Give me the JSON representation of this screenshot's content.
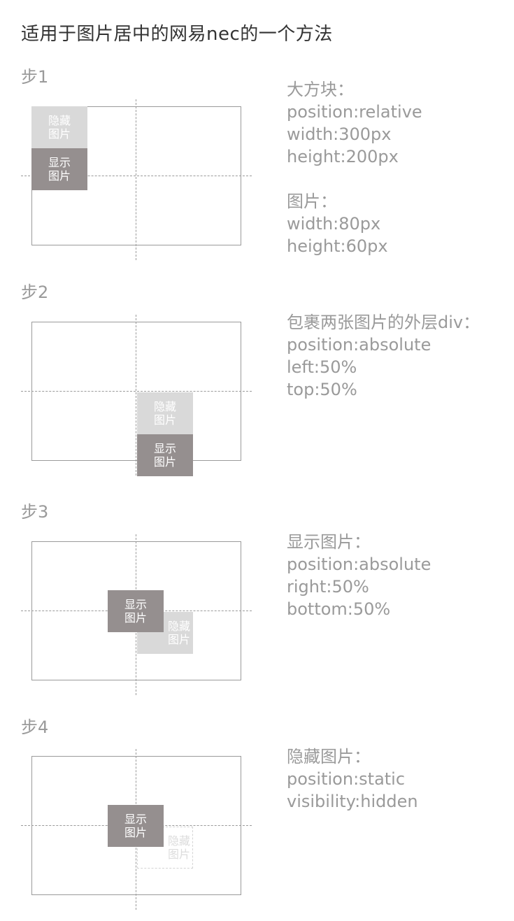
{
  "title": "适用于图片居中的网易nec的一个方法",
  "image_labels": {
    "hidden_line1": "隐藏",
    "hidden_line2": "图片",
    "shown_line1": "显示",
    "shown_line2": "图片"
  },
  "steps": [
    {
      "label": "步1",
      "notes": [
        {
          "header": "大方块：",
          "lines": [
            "position:relative",
            "width:300px",
            "height:200px"
          ]
        },
        {
          "header": "图片：",
          "lines": [
            "width:80px",
            "height:60px"
          ]
        }
      ]
    },
    {
      "label": "步2",
      "notes": [
        {
          "header": "包裹两张图片的外层div：",
          "lines": [
            "position:absolute",
            "left:50%",
            "top:50%"
          ]
        }
      ]
    },
    {
      "label": "步3",
      "notes": [
        {
          "header": "显示图片：",
          "lines": [
            "position:absolute",
            "right:50%",
            "bottom:50%"
          ]
        }
      ]
    },
    {
      "label": "步4",
      "notes": [
        {
          "header": "隐藏图片：",
          "lines": [
            "position:static",
            "visibility:hidden"
          ]
        }
      ]
    }
  ]
}
